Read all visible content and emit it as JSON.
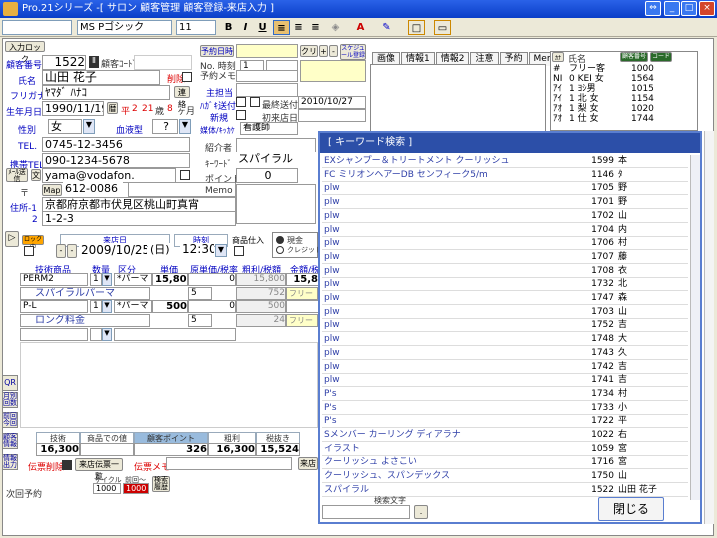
{
  "window": {
    "title": "Pro.21シリーズ -[ サロン 顧客管理 顧客登録-来店入力 ]"
  },
  "toolbar": {
    "font_name": "MS Pゴシック",
    "font_size": "11",
    "bold": "B",
    "italic": "I",
    "underline": "U"
  },
  "customer": {
    "small_btn": "入力ロック",
    "no_label": "顧客番号",
    "no": "1522",
    "code_label": "顧客ｺｰﾄﾞ",
    "name_label": "氏名",
    "name": "山田 花子",
    "delete_label": "削除",
    "kana_label": "フリガナ",
    "kana": "ﾔﾏﾀﾞ ﾊﾅｺ",
    "link_btn": "連絡",
    "birth_label": "生年月日",
    "birth": "1990/11/19",
    "era": "平",
    "era_year": "2",
    "age": "21",
    "age_unit": "歳",
    "months": "8",
    "month_unit": "ヶ月",
    "sex_label": "性別",
    "sex": "女",
    "blood_label": "血液型",
    "blood": "?",
    "tel_label": "TEL.",
    "tel": "0745-12-3456",
    "mobile_label": "携帯TEL",
    "mobile": "090-1234-5678",
    "mail_btn": "ﾒｰﾙ送信",
    "mail_btn2": "文",
    "email": "yama@vodafon.",
    "zip_label": "〒",
    "map_btn": "Map",
    "zip": "612-0086",
    "addr_label": "住所-1",
    "addr1": "京都府京都市伏見区桃山町真宵",
    "addr2_label": "2",
    "addr2": "1-2-3"
  },
  "middle": {
    "yoyaku_btn": "予約日時",
    "clear_btn": "クリア",
    "plus": "+",
    "minus": "-",
    "sched_btn": "スケジュール登録",
    "no_time_label": "No. 時刻",
    "no_val": "1",
    "yoyaku_memo_label": "予約メモ",
    "tanto_label": "主担当",
    "tanto_val": "",
    "hagaki_label": "ﾊｶﾞｷ送付",
    "hagaki_check_label": "最終送付",
    "hagaki_date": "2010/10/27",
    "shinki_label": "新規",
    "first_label": "初来店日",
    "first_date": "",
    "kikkake_label": "媒体/ｷｯｶｹ",
    "kikkake_val": "看護師",
    "intro_label": "紹介者",
    "keyword_label": "ｷｰﾜｰﾄﾞ",
    "keyword_val": "スパイラル",
    "point_label": "ポイント",
    "point_val": "0",
    "memo_label": "Memo"
  },
  "right": {
    "tabs": [
      "画像",
      "情報1",
      "情報2",
      "注意",
      "予約",
      "Memo"
    ],
    "list_header_label": "氏名",
    "new_btn": "顧客番号",
    "code_btn": "コード",
    "list": [
      {
        "k": "#",
        "name": "フリー客",
        "no": "1000"
      },
      {
        "k": "NI",
        "name": "0 KEI 女",
        "no": "1564"
      },
      {
        "k": "ｱｲ",
        "name": "1 ﾖｼ男",
        "no": "1015"
      },
      {
        "k": "ｱｲ",
        "name": "1 北 女",
        "no": "1154"
      },
      {
        "k": "ｱｵ",
        "name": "1 梨 女",
        "no": "1020"
      },
      {
        "k": "ｱｵ",
        "name": "1 仕 女",
        "no": "1744"
      }
    ]
  },
  "visit": {
    "lock_btn": "ロック中",
    "date_label": "来店日",
    "date": "2009/10/25",
    "weekday": "(日)",
    "time_label": "時刻",
    "time": "12:30",
    "shohin_label": "商品仕入",
    "cash_label": "現金",
    "credit_label": "クレジット",
    "headers": [
      "技術商品",
      "数量",
      "区分",
      "単価",
      "原単価/税率",
      "粗利/税額",
      "金額/税込"
    ],
    "rows": [
      {
        "item": "PERM2",
        "qty": "1",
        "kubun": "*パーマ",
        "price": "15,800",
        "cost": "0",
        "profit": "15,800",
        "amount": "15,8",
        "sub": "スパイラルパーマ",
        "sub_cost": "5",
        "sub_tax": "752",
        "sub_amt": "フリー"
      },
      {
        "item": "P-L",
        "qty": "1",
        "kubun": "*パーマ",
        "price": "500",
        "cost": "0",
        "profit": "500",
        "amount": "",
        "sub": "ロング料金",
        "sub_cost": "5",
        "sub_tax": "24",
        "sub_amt": "フリー"
      }
    ],
    "totals_headers": [
      "技術",
      "商品での値",
      "顧客ポイント",
      "粗利",
      "税抜き"
    ],
    "totals": {
      "tech": "16,300",
      "goods": "",
      "point": "326",
      "profit": "16,300",
      "net": "15,524"
    },
    "denpyo_btn": "伝票削除",
    "history_btn": "来店伝票一覧",
    "memo_label": "伝票メモ",
    "raiten_btn": "来店",
    "cycle_label": "サイクル",
    "cycle_val": "1000",
    "last_label": "前回～",
    "last_val": "1000",
    "kensaku_btn": "検索履歴",
    "next_label": "次回予約"
  },
  "side_buttons": [
    "QR",
    "月別回数",
    "前回今回",
    "顧客情報",
    "情報出力"
  ],
  "keyword_panel": {
    "title": "[ キーワード検索 ]",
    "rows": [
      {
        "kw": "EXシャンプー＆トリートメント クーリッシュ",
        "no": "1599",
        "c": "本"
      },
      {
        "kw": "FC ミリオンヘアーDB センフィーク5/m",
        "no": "1146",
        "c": "ﾀ"
      },
      {
        "kw": "plw",
        "no": "1705",
        "c": "野"
      },
      {
        "kw": "plw",
        "no": "1701",
        "c": "野"
      },
      {
        "kw": "plw",
        "no": "1702",
        "c": "山"
      },
      {
        "kw": "plw",
        "no": "1704",
        "c": "内"
      },
      {
        "kw": "plw",
        "no": "1706",
        "c": "村"
      },
      {
        "kw": "plw",
        "no": "1707",
        "c": "藤"
      },
      {
        "kw": "plw",
        "no": "1708",
        "c": "衣"
      },
      {
        "kw": "plw",
        "no": "1732",
        "c": "北"
      },
      {
        "kw": "plw",
        "no": "1747",
        "c": "森"
      },
      {
        "kw": "plw",
        "no": "1703",
        "c": "山"
      },
      {
        "kw": "plw",
        "no": "1752",
        "c": "吉"
      },
      {
        "kw": "plw",
        "no": "1748",
        "c": "大"
      },
      {
        "kw": "plw",
        "no": "1743",
        "c": "久"
      },
      {
        "kw": "plw",
        "no": "1742",
        "c": "吉"
      },
      {
        "kw": "plw",
        "no": "1741",
        "c": "吉"
      },
      {
        "kw": "P's",
        "no": "1734",
        "c": "村"
      },
      {
        "kw": "P's",
        "no": "1733",
        "c": "小"
      },
      {
        "kw": "P's",
        "no": "1722",
        "c": "平"
      },
      {
        "kw": "Sメンバー カーリング ディアラナ",
        "no": "1022",
        "c": "右"
      },
      {
        "kw": "イラスト",
        "no": "1059",
        "c": "宮"
      },
      {
        "kw": "クーリッシュ よさこい",
        "no": "1716",
        "c": "宮"
      },
      {
        "kw": "クーリッシュ、スパンデックス",
        "no": "1750",
        "c": "山"
      },
      {
        "kw": "スパイラル",
        "no": "1522",
        "c": "山田 花子"
      }
    ],
    "search_label": "検索文字",
    "search_value": "",
    "close_btn": "閉じる"
  },
  "colors": {
    "title_bar": "#0a3ec8",
    "keyword_header": "#2c4fa8",
    "accent_yellow": "#ffffc8",
    "red_btn": "#cc0000"
  }
}
